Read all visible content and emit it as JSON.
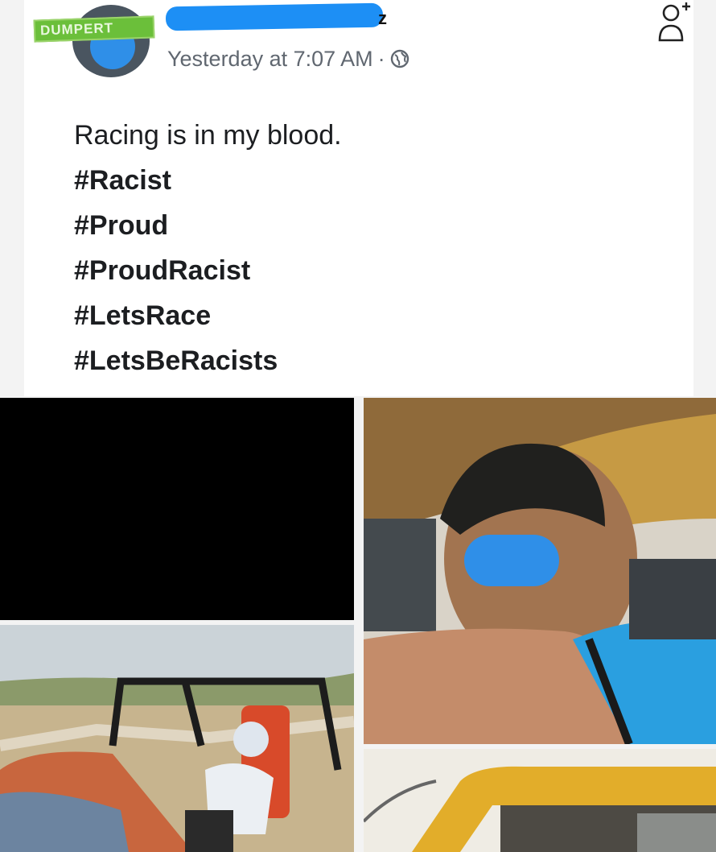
{
  "watermark": "DUMPERT",
  "post": {
    "author_tail": "z",
    "timestamp": "Yesterday at 7:07 AM",
    "separator": "·",
    "privacy_icon": "globe-icon",
    "lines": [
      {
        "text": "Racing is in my blood.",
        "kind": "text"
      },
      {
        "text": "#Racist",
        "kind": "tag"
      },
      {
        "text": "#Proud",
        "kind": "tag"
      },
      {
        "text": "#ProudRacist",
        "kind": "tag"
      },
      {
        "text": "#LetsRace",
        "kind": "tag"
      },
      {
        "text": "#LetsBeRacists",
        "kind": "tag"
      }
    ]
  },
  "actions": {
    "add_friend_icon": "add-friend-icon"
  },
  "colors": {
    "redaction": "#1d8ff5",
    "watermark_green": "#6bbf3a",
    "text": "#1c1e21",
    "meta": "#606770"
  },
  "photos": [
    "photo-black-frame",
    "photo-boy-in-car",
    "photo-offroad-buggy",
    "photo-yellow-car-roof"
  ]
}
